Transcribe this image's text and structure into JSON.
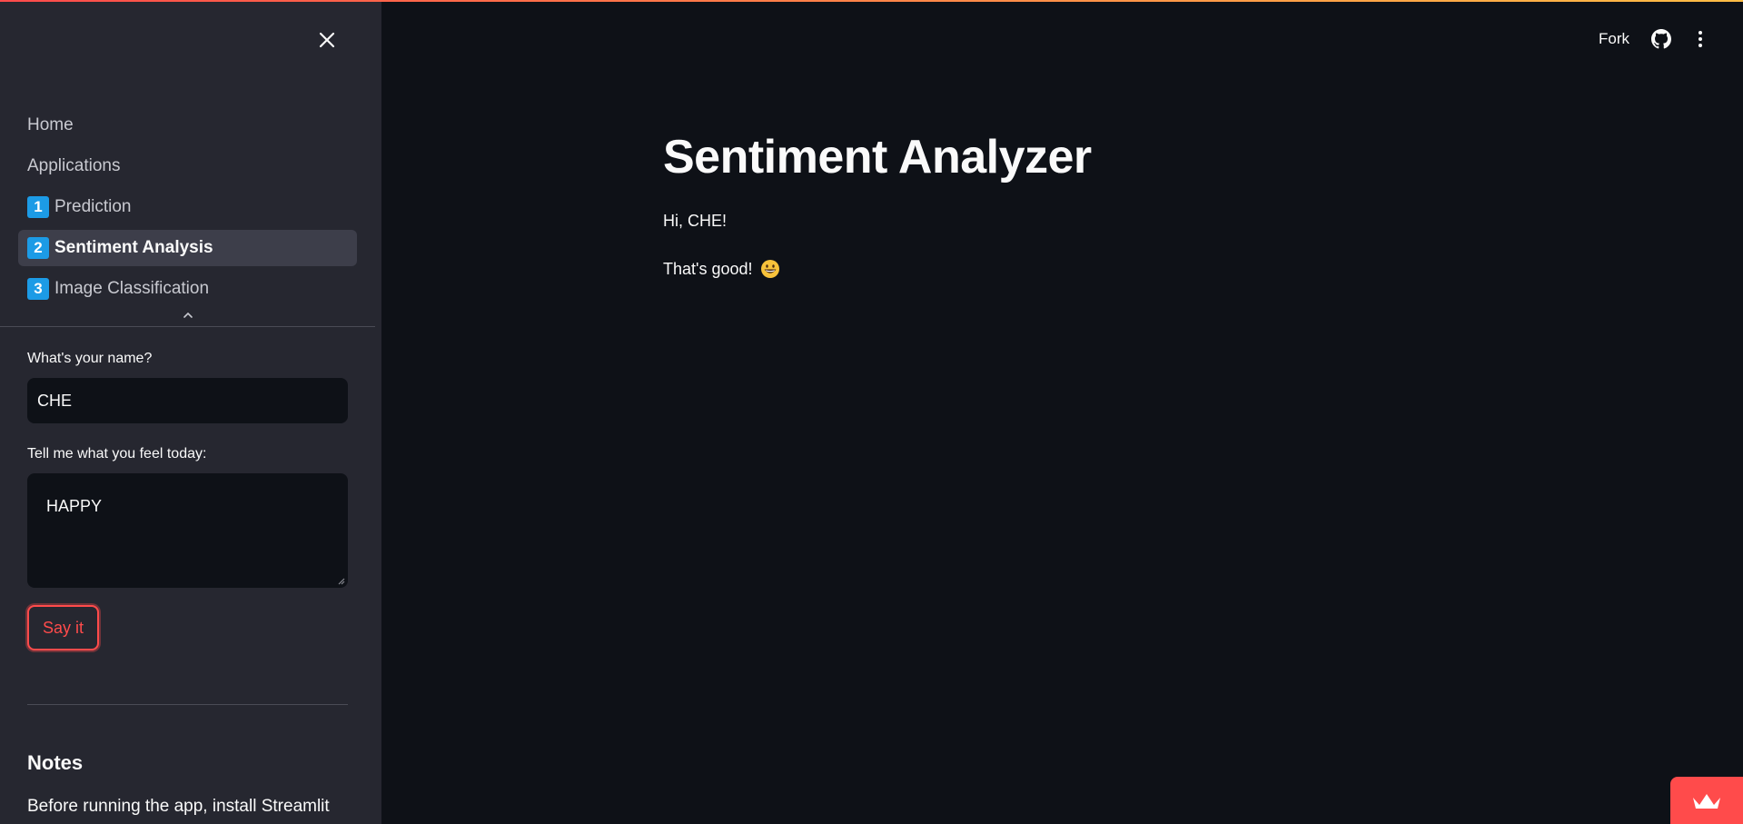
{
  "sidebar": {
    "nav": [
      {
        "label": "Home",
        "num": ""
      },
      {
        "label": "Applications",
        "num": ""
      },
      {
        "label": "Prediction",
        "num": "1"
      },
      {
        "label": "Sentiment Analysis",
        "num": "2",
        "active": true
      },
      {
        "label": "Image Classification",
        "num": "3"
      }
    ],
    "name_label": "What's your name?",
    "name_value": "CHE",
    "feel_label": "Tell me what you feel today:",
    "feel_value": "HAPPY",
    "submit_label": "Say it",
    "notes_heading": "Notes",
    "notes_text": "Before running the app, install Streamlit"
  },
  "header": {
    "fork_label": "Fork",
    "github_icon": "github-icon",
    "menu_icon": "kebab-menu-icon"
  },
  "main": {
    "title": "Sentiment Analyzer",
    "greeting": "Hi, CHE!",
    "result": "That's good!",
    "result_emoji": "grinning-face-icon"
  },
  "colors": {
    "accent": "#ff4b4b",
    "nav_badge": "#1c9be6",
    "sidebar_bg": "#262730",
    "main_bg": "#0e1117"
  }
}
